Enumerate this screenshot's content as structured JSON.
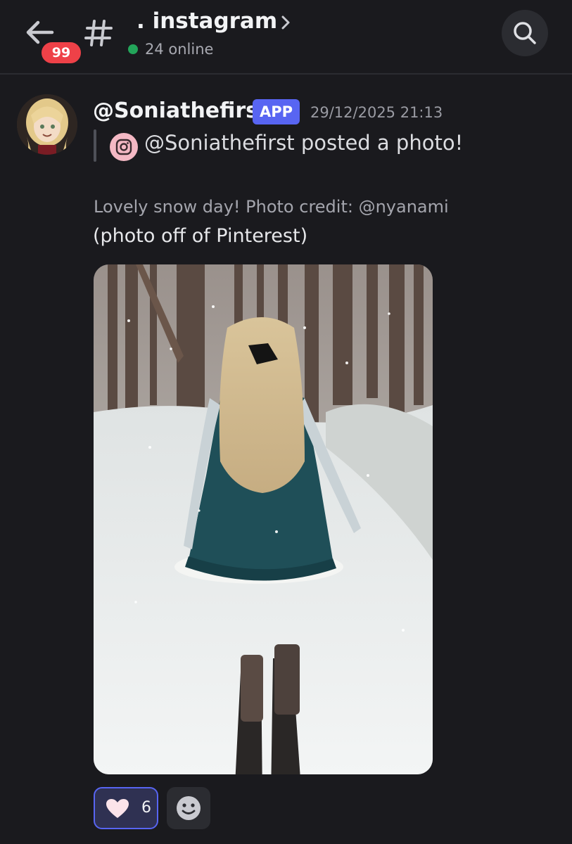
{
  "header": {
    "back_icon": "arrow-left-icon",
    "unread_badge": "99",
    "channel_icon": "hash-icon",
    "channel_name": ". instagram",
    "chevron_icon": "chevron-right-icon",
    "online_count_text": "24 online",
    "online_color": "#23a55a",
    "search_icon": "search-icon"
  },
  "message": {
    "author": "@Soniathefirst",
    "app_tag": "APP",
    "timestamp": "29/12/2025 21:13",
    "reply_icon": "instagram-icon",
    "posted_line": "@Soniathefirst posted a photo!",
    "caption_line1": "Lovely snow day! Photo credit: @nyanami",
    "caption_line2": "(photo off of Pinterest)",
    "photo_description_icon": "photo-image",
    "reactions": [
      {
        "icon": "heart-icon",
        "count": "6",
        "selected": true
      }
    ],
    "add_reaction_icon": "smiley-icon"
  },
  "colors": {
    "background": "#1a1a1e",
    "accent": "#5865f2",
    "badge": "#ee4148"
  }
}
